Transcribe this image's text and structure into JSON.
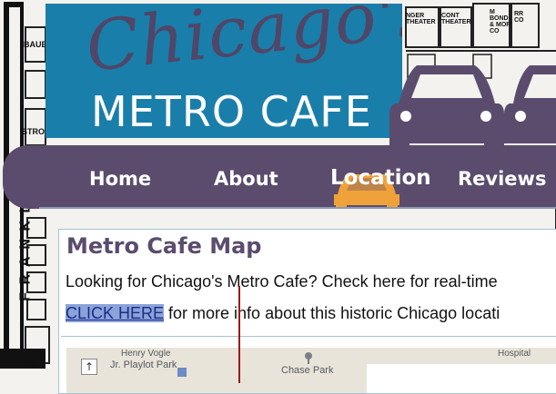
{
  "background": {
    "street_labels": [
      "BAUE",
      "STRO",
      "ST",
      "F R A N K L I N",
      "NGER THEATER",
      "CONT THEATER",
      "M BOND & MOR CO",
      "RR CO"
    ]
  },
  "logo": {
    "script_text": "Chicago's",
    "main_text": "METRO CAFE"
  },
  "nav": {
    "items": [
      {
        "label": "Home"
      },
      {
        "label": "About"
      },
      {
        "label": "Location"
      },
      {
        "label": "Reviews"
      }
    ]
  },
  "content": {
    "title": "Metro Cafe Map",
    "intro_text": "Looking for Chicago's Metro Cafe? Check here for real-time",
    "link_text": "CLICK HERE",
    "link_suffix": " for more info about this historic Chicago locati"
  },
  "map": {
    "labels": [
      "Henry Vogle",
      "Jr. Playlot Park",
      "Chase Park",
      "Hospital"
    ],
    "button_icon": "up-arrow-icon"
  },
  "colors": {
    "logo_blue": "#1a7eaa",
    "brand_purple": "#5b4c6d",
    "location_orange": "#f0a23a",
    "link_highlight": "#8aa3d8"
  }
}
